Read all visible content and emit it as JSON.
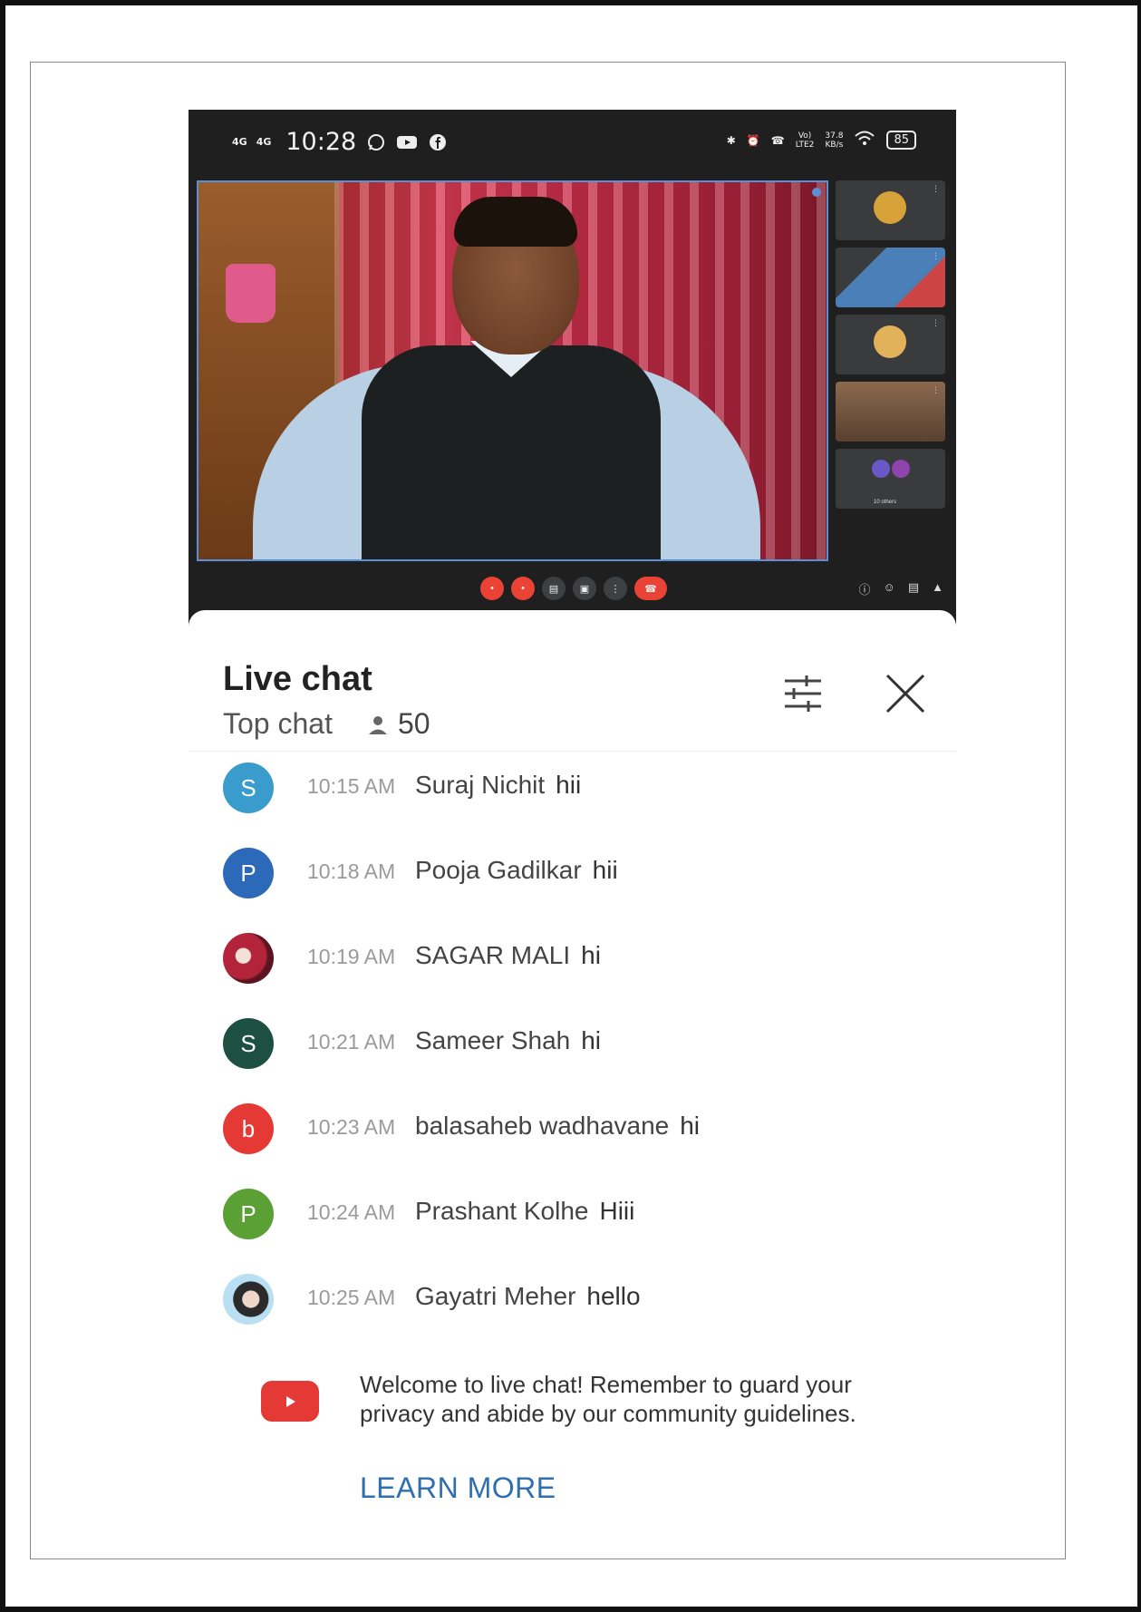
{
  "status_bar": {
    "signal_1": "4G",
    "signal_2": "4G",
    "time": "10:28",
    "network_type": "LTE2",
    "network_volte": "Vo)",
    "speed_value": "37.8",
    "speed_unit": "KB/s",
    "battery": "85"
  },
  "meet": {
    "others_label": "10 others",
    "controls": [
      "mic",
      "camera",
      "captions",
      "present",
      "more",
      "end-call"
    ]
  },
  "chat": {
    "title": "Live chat",
    "mode": "Top chat",
    "viewer_count": "50",
    "messages": [
      {
        "initial": "S",
        "avatar_color": "#3a9ccc",
        "time": "10:15 AM",
        "author": "Suraj Nichit",
        "text": "hii"
      },
      {
        "initial": "P",
        "avatar_color": "#2c69b8",
        "time": "10:18 AM",
        "author": "Pooja Gadilkar",
        "text": "hii"
      },
      {
        "initial": "",
        "avatar_color": "#b3243a",
        "time": "10:19 AM",
        "author": "SAGAR MALI",
        "text": "hi"
      },
      {
        "initial": "S",
        "avatar_color": "#1d5040",
        "time": "10:21 AM",
        "author": "Sameer Shah",
        "text": "hi"
      },
      {
        "initial": "b",
        "avatar_color": "#e53935",
        "time": "10:23 AM",
        "author": "balasaheb wadhavane",
        "text": "hi"
      },
      {
        "initial": "P",
        "avatar_color": "#5aa034",
        "time": "10:24 AM",
        "author": "Prashant Kolhe",
        "text": "Hiii"
      },
      {
        "initial": "",
        "avatar_color": "#b9dff2",
        "time": "10:25 AM",
        "author": "Gayatri Meher",
        "text": "hello"
      }
    ],
    "welcome_text": "Welcome to live chat! Remember to guard your privacy and abide by our community guidelines.",
    "learn_more": "LEARN MORE"
  },
  "colors": {
    "accent_link": "#2f6fb0",
    "youtube_red": "#e53935"
  }
}
